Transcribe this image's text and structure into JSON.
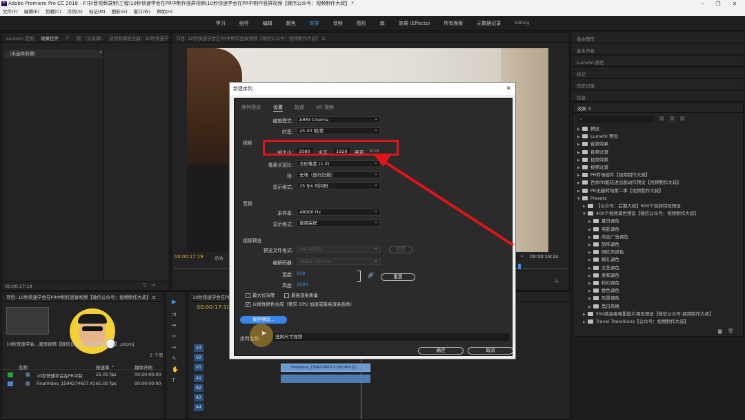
{
  "window": {
    "title": "Adobe Premiere Pro CC 2018 - F:\\抖音视频录制\\工程\\10秒快速学会在PR中制作竖屏视频\\10秒快速学会在PR中制作竖屏视频【微信公众号：视频制作大叔】 *",
    "app_icon": "Pr"
  },
  "menu": [
    "文件(F)",
    "编辑(E)",
    "剪辑(C)",
    "序列(S)",
    "标记(M)",
    "图形(G)",
    "窗口(W)",
    "帮助(H)"
  ],
  "workspaces": [
    "学习",
    "组件",
    "编辑",
    "颜色",
    "效果",
    "音频",
    "图形",
    "库",
    "效果 (Effects)",
    "所有面板",
    "元数据记录",
    "Editing"
  ],
  "active_workspace": "效果",
  "left_top_panel": {
    "tabs": [
      "Lumetri 范围",
      "效果控件",
      "≡",
      "源：(无剪辑)",
      "音频剪辑混合器：10秒快速学会在PR中制作竖屏视频"
    ],
    "no_clip": "（未选择剪辑）",
    "timecode": "00:00:17:19"
  },
  "program_monitor": {
    "title": "节目: 10秒快速学会在PR中制作竖屏视频【微信公众号：视频制作大叔】 ≡",
    "timecode_left": "00:00:17:19",
    "timecode_right": "00:00:19:24",
    "fit": "适合"
  },
  "project_panel": {
    "title": "项目: 10秒快速学会在PR中制作竖屏视频【微信公众号：视频制作大叔】 ≡",
    "file": "10秒快速学会...竖屏视频【微信公众号：视频制作大叔】.prproj",
    "count": "2 个项",
    "columns": [
      "名称",
      "帧速率 ⌃",
      "媒体开始"
    ],
    "rows": [
      {
        "name": "10秒快速学会在PR中制",
        "fps": "25.00 fps",
        "start": "00:00:00:00",
        "color": "#2f9e47"
      },
      {
        "name": "FinalVideo_1594274607.4198",
        "fps": "60.00 fps",
        "start": "00:00:00:00",
        "color": "#4c86c9"
      }
    ]
  },
  "timeline": {
    "title": "10秒快速学会在PR中制作竖屏视频【微信公众号：视频制作大叔】 ≡",
    "timecode": "00:00:17:10",
    "video_tracks": [
      "V3",
      "V2",
      "V1"
    ],
    "audio_tracks": [
      "A1",
      "A2",
      "A3",
      "A4"
    ],
    "clip_name": "FinalVideo_1594274607.4198.MP4 [V]"
  },
  "right_panels": {
    "top_items": [
      "基本图形",
      "基本声音",
      "Lumetri 颜色",
      "标记",
      "历史记录",
      "信息"
    ],
    "effects_title": "效果 ≡",
    "effects_tree": [
      {
        "label": "预设",
        "level": 0
      },
      {
        "label": "Lumetri 预设",
        "level": 0
      },
      {
        "label": "音频效果",
        "level": 0
      },
      {
        "label": "音频过渡",
        "level": 0
      },
      {
        "label": "视频效果",
        "level": 0
      },
      {
        "label": "视频过渡",
        "level": 0
      },
      {
        "label": "PR转场插件【视频制作大叔】",
        "level": 0
      },
      {
        "label": "百余PR酷炫进出画动作预设【视频制作大叔】",
        "level": 0
      },
      {
        "label": "PR无缝转场第二季【视频制作大叔】",
        "level": 0
      },
      {
        "label": "Presets",
        "level": 0
      },
      {
        "label": "【公众号：后期大叔】600个视频特效预设",
        "level": 1
      },
      {
        "label": "400个视频调色预设【微信公众号：视频制作大叔】",
        "level": 1
      },
      {
        "label": "夏日调色",
        "level": 2
      },
      {
        "label": "电影调色",
        "level": 2
      },
      {
        "label": "商业广告调色",
        "level": 2
      },
      {
        "label": "恐怖调色",
        "level": 2
      },
      {
        "label": "网红风调色",
        "level": 2
      },
      {
        "label": "婚礼调色",
        "level": 2
      },
      {
        "label": "文艺调色",
        "level": 2
      },
      {
        "label": "柔和调色",
        "level": 2
      },
      {
        "label": "科幻调色",
        "level": 2
      },
      {
        "label": "橙色调色",
        "level": 2
      },
      {
        "label": "风景调色",
        "level": 2
      },
      {
        "label": "黑白风格",
        "level": 2
      },
      {
        "label": "550款高级电影胶片调色预设【微信公众号:视频制作大叔】",
        "level": 1
      },
      {
        "label": "Travel Transitions【公众号：视频制作大叔】",
        "level": 1
      }
    ]
  },
  "dialog": {
    "title": "新建序列",
    "tabs": [
      "序列预设",
      "设置",
      "轨道",
      "VR 视频"
    ],
    "active_tab": "设置",
    "editing_mode_label": "编辑模式:",
    "editing_mode": "ARRI Cinema",
    "timebase_label": "时基:",
    "timebase": "25.00 帧/秒",
    "video_section": "视频",
    "frame_size_label": "帧大小:",
    "frame_w": "1080",
    "horizontal_label": "水平",
    "frame_h": "1920",
    "vertical_label": "垂直",
    "aspect": "9:16",
    "pixel_aspect_label": "像素长宽比:",
    "pixel_aspect": "方形像素 (1.0)",
    "fields_label": "场:",
    "fields": "无场（逐行扫描）",
    "display_format_label": "显示格式:",
    "display_format": "25 fps 时间码",
    "audio_section": "音频",
    "sample_rate_label": "采样率:",
    "sample_rate": "48000 Hz",
    "audio_display_label": "显示格式:",
    "audio_display": "音频采样",
    "preview_section": "视频预览",
    "preview_format_label": "预览文件格式:",
    "preview_format": "I 帧 MPEG",
    "config_button": "配置",
    "codec_label": "编解码器:",
    "codec": "MPEG I-Frame",
    "width_label": "宽度:",
    "width": "608",
    "height_label": "高度:",
    "height": "1080",
    "reset_button": "重置",
    "max_bit_depth": "最大位深度",
    "max_render_quality": "最高渲染质量",
    "linear_color": "以线性颜色合成（要求 GPU 加速或最高渲染品质）",
    "save_preset": "保存预设...",
    "sequence_name_label": "序列名称:",
    "sequence_name": "竖屏尺寸视频",
    "ok": "确定",
    "cancel": "取消"
  },
  "colors": {
    "accent": "#4a8fe0",
    "highlight_box": "#e0151b",
    "arrow": "#e0151b",
    "save_button": "#3a86e6"
  }
}
